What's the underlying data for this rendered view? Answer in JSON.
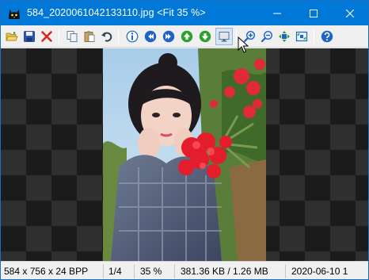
{
  "window": {
    "title": "584_2020061042133110.jpg <Fit 35 %>"
  },
  "titlebar_buttons": [
    "minimize-icon",
    "maximize-icon",
    "close-icon"
  ],
  "toolbar": {
    "buttons": [
      "open-folder-icon",
      "save-icon",
      "delete-icon",
      "copy-icon",
      "paste-icon",
      "undo-icon",
      "info-icon",
      "previous-icon",
      "next-icon",
      "up-icon",
      "down-icon",
      "fullscreen-icon",
      "zoom-in-icon",
      "zoom-out-icon",
      "fit-icon",
      "actual-size-icon",
      "help-icon"
    ],
    "colors": {
      "blue": "#1f63c6",
      "green": "#2aa12a",
      "red": "#d9261c",
      "yellow": "#e7b416"
    }
  },
  "status": {
    "dimensions": "584 x 756 x 24 BPP",
    "index": "1/4",
    "zoom": "35 %",
    "size": "381.36 KB / 1.26 MB",
    "date": "2020-06-10 1"
  }
}
